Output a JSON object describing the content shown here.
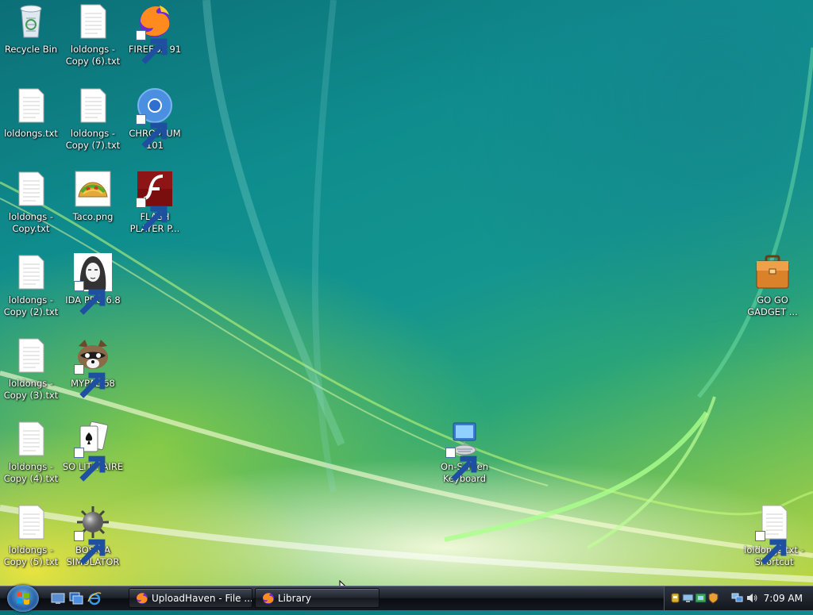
{
  "desktop": {
    "icons": {
      "recycle_bin": "Recycle Bin",
      "loldongs": "loldongs.txt",
      "loldongs_copy": "loldongs - Copy.txt",
      "loldongs_copy2": "loldongs - Copy (2).txt",
      "loldongs_copy3": "loldongs - Copy (3).txt",
      "loldongs_copy4": "loldongs - Copy (4).txt",
      "loldongs_copy5": "loldongs - Copy (5).txt",
      "loldongs_copy6": "loldongs - Copy (6).txt",
      "loldongs_copy7": "loldongs - Copy (7).txt",
      "taco": "Taco.png",
      "ida": "IDA PRO 6.8",
      "mypal": "MYPAL 68",
      "solitaire": "SO LIT!! AIRE",
      "bosnia": "BOSNIA SIMULATOR",
      "firefox": "FIREFOX 91",
      "chromium": "CHROMIUM 101",
      "flash": "FLASH PLAYER P...",
      "osk": "On-Screen Keyboard",
      "gadget": "GO GO GADGET ...",
      "loldongs_shortcut": "loldongs.txt - Shortcut"
    }
  },
  "taskbar": {
    "quicklaunch": [
      "show-desktop-icon",
      "switch-windows-icon",
      "internet-explorer-icon"
    ],
    "tasks": [
      {
        "label": "UploadHaven - File ...",
        "icon": "firefox-icon"
      },
      {
        "label": "Library",
        "icon": "firefox-icon"
      }
    ],
    "tray_icons": [
      "usb-icon",
      "network-share-icon",
      "windows-defender-icon",
      "security-center-icon",
      "network-icon",
      "volume-icon"
    ],
    "clock": "7:09 AM"
  },
  "colors": {
    "accent": "#235b9e",
    "taskbar": "#1b1f26"
  }
}
